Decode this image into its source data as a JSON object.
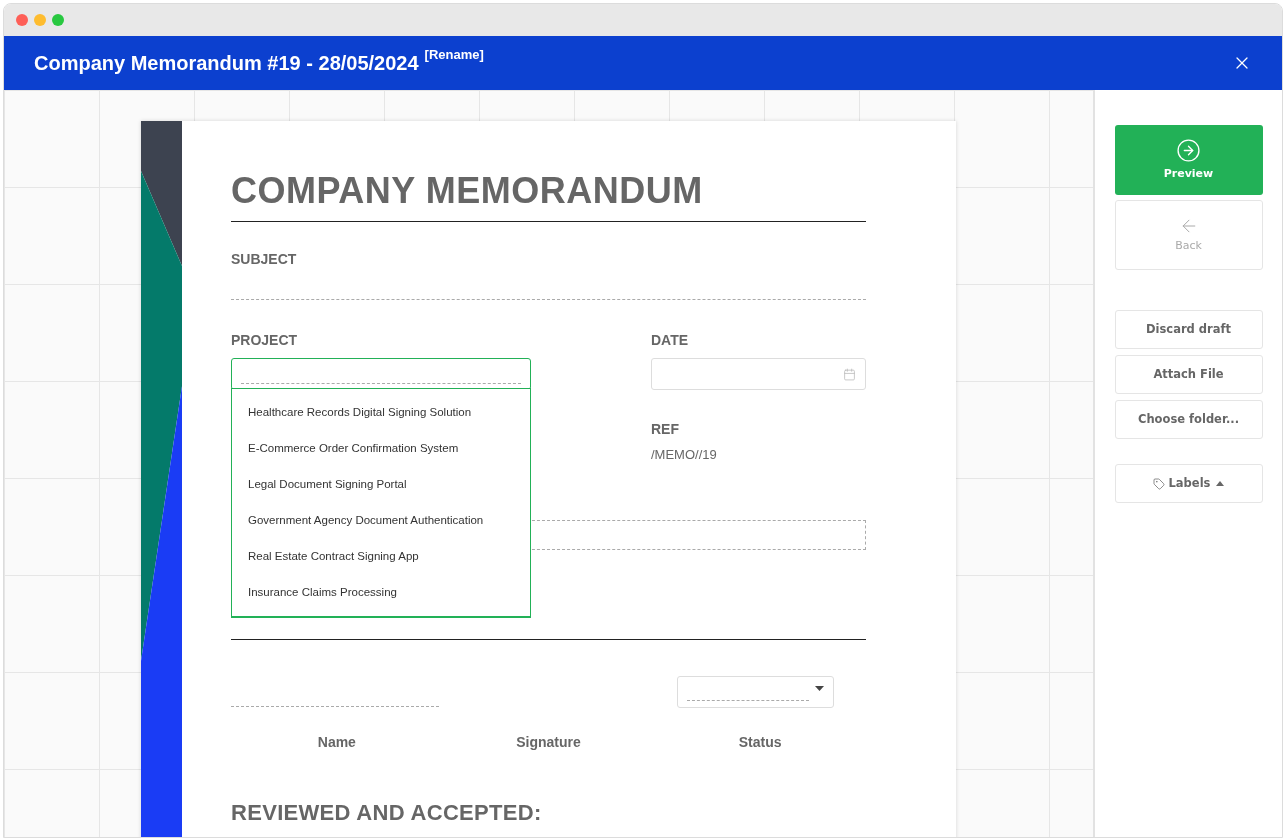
{
  "window": {
    "title": "Company Memorandum #19 - 28/05/2024",
    "rename_link": "[Rename]"
  },
  "document": {
    "title": "COMPANY MEMORANDUM",
    "subject_label": "SUBJECT",
    "project_label": "PROJECT",
    "date_label": "DATE",
    "ref_label": "REF",
    "ref_value": "/MEMO//19",
    "project_dropdown": {
      "expanded": true,
      "options": [
        {
          "label": "Healthcare Records Digital Signing Solution"
        },
        {
          "label": "E-Commerce Order Confirmation System"
        },
        {
          "label": "Legal Document Signing Portal"
        },
        {
          "label": "Government Agency Document Authentication"
        },
        {
          "label": "Real Estate Contract Signing App"
        },
        {
          "label": "Insurance Claims Processing"
        }
      ]
    },
    "signature_columns": [
      "Name",
      "Signature",
      "Status"
    ],
    "reviewed_heading": "REVIEWED AND ACCEPTED:"
  },
  "sidebar": {
    "preview": {
      "label": "Preview"
    },
    "back": {
      "label": "Back",
      "disabled": true
    },
    "actions": [
      "Discard draft",
      "Attach File",
      "Choose folder..."
    ],
    "labels": {
      "label": "Labels",
      "expanded": true
    }
  }
}
